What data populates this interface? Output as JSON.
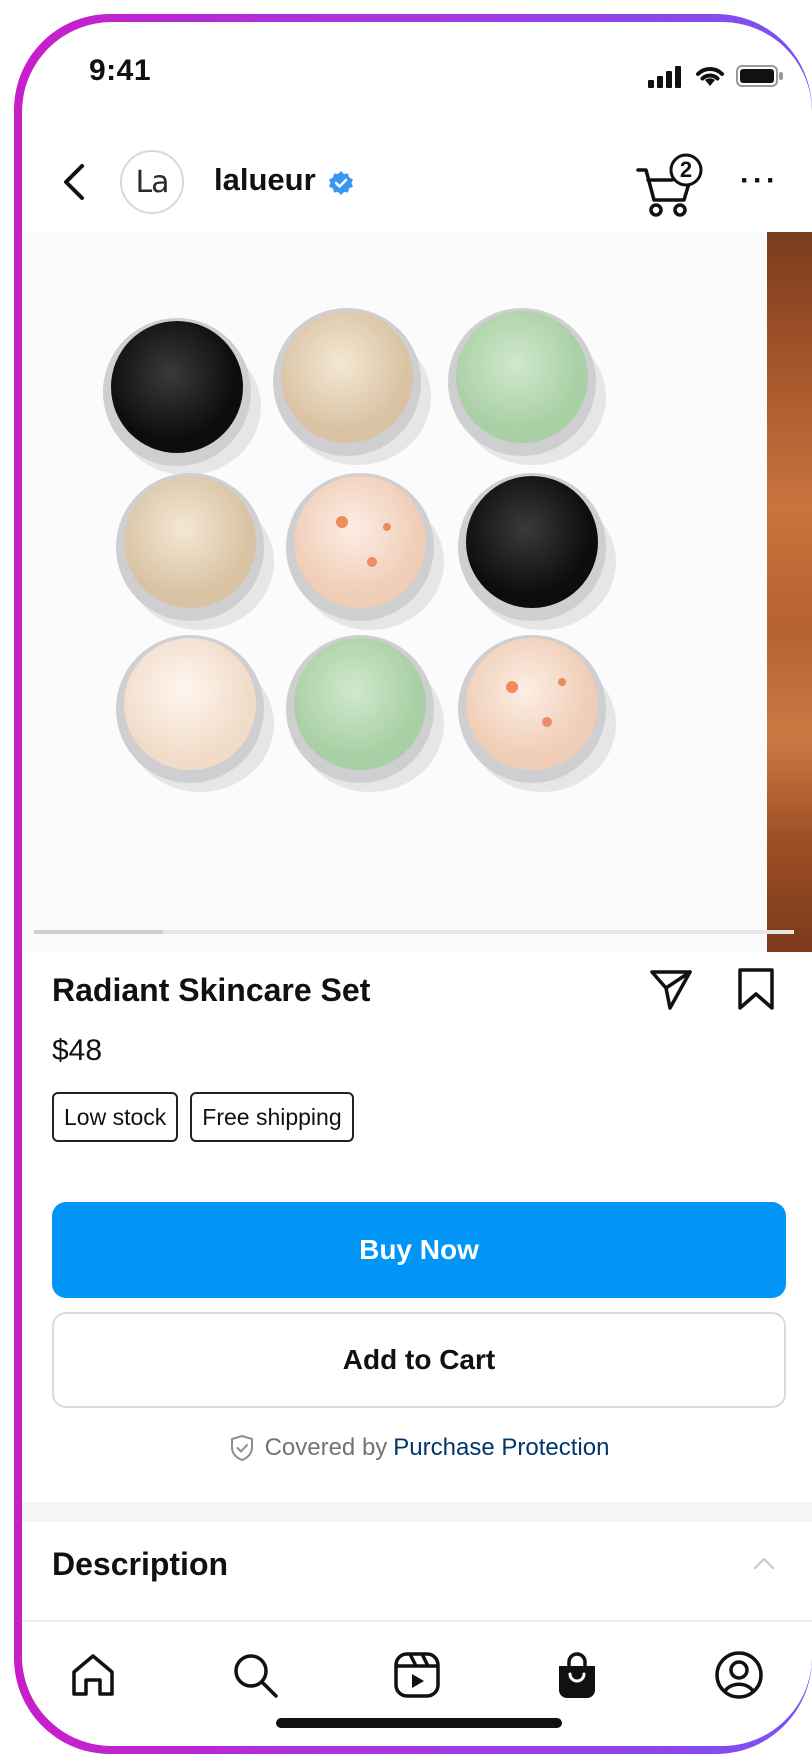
{
  "status_bar": {
    "time": "9:41",
    "icons": [
      "signal-icon",
      "wifi-icon",
      "battery-icon"
    ]
  },
  "header": {
    "back_icon": "chevron-left-icon",
    "avatar_text": "La",
    "handle": "lalueur",
    "verified_icon": "verified-badge-icon",
    "cart_count": "2",
    "more_icon": "more-horizontal-icon"
  },
  "gallery": {
    "current_index": 1,
    "progress_fraction": 0.17
  },
  "product": {
    "title": "Radiant Skincare Set",
    "price": "$48",
    "badges": [
      "Low stock",
      "Free shipping"
    ],
    "share_icon": "send-icon",
    "save_icon": "bookmark-icon"
  },
  "actions": {
    "buy_label": "Buy Now",
    "cart_label": "Add to Cart"
  },
  "protection": {
    "prefix": "Covered by",
    "link": "Purchase Protection",
    "icon": "shield-check-icon"
  },
  "description": {
    "heading": "Description",
    "icon": "chevron-up-icon"
  },
  "tabbar": {
    "items": [
      "home-icon",
      "search-icon",
      "reels-icon",
      "shop-icon",
      "profile-icon"
    ],
    "active": "shop-icon"
  },
  "colors": {
    "accent": "#0095f6",
    "link": "#00376b",
    "frame_left": "#c81ec9",
    "frame_right": "#7b52f3"
  }
}
